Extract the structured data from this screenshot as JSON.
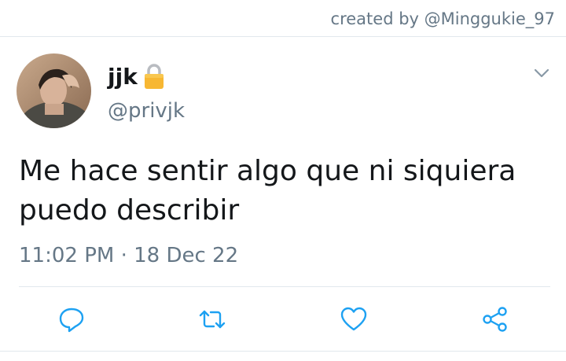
{
  "credit": "created by @Minggukie_97",
  "tweet": {
    "display_name": "jjk",
    "handle": "@privjk",
    "text_line1": "Me hace sentir algo que ni siquiera",
    "text_line2": "puedo describir",
    "timestamp": "11:02 PM · 18 Dec 22",
    "protected": true
  },
  "icons": {
    "lock": "lock-icon",
    "menu": "chevron-down-icon",
    "reply": "reply-icon",
    "retweet": "retweet-icon",
    "like": "heart-icon",
    "share": "share-icon"
  },
  "colors": {
    "text": "#14171a",
    "secondary": "#657786",
    "icon": "#1da1f2",
    "divider": "#e1e8ed"
  }
}
